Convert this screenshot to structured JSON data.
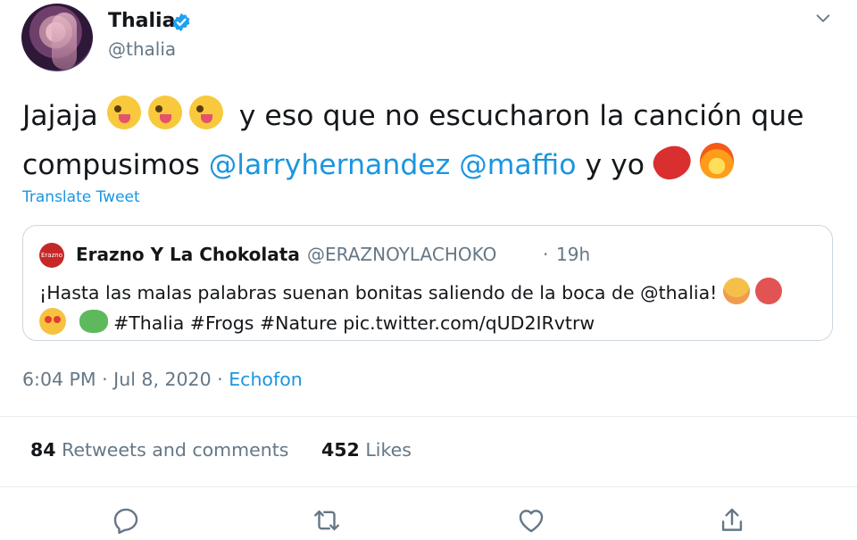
{
  "author": {
    "name": "Thalia",
    "handle": "@thalia"
  },
  "tweet": {
    "text_line1_start": "Jajaja",
    "text_line1_end": "y eso que no escucharon la canción que",
    "text_line2_start": "compusimos",
    "mention1": "@larryhernandez",
    "mention2": "@maffio",
    "text_line2_end": "y yo",
    "translate_label": "Translate Tweet",
    "emojis": [
      "winking-tongue-emoji",
      "winking-tongue-emoji",
      "winking-tongue-emoji",
      "hot-pepper-emoji",
      "fire-emoji"
    ]
  },
  "quoted_tweet": {
    "avatar_text": "Erazno Chokolata",
    "name": "Erazno Y La Chokolata",
    "handle": "@ERAZNOYLACHOKO",
    "dot": "·",
    "time": "19h",
    "text_line1": "¡Hasta las malas palabras suenan bonitas saliendo de la boca de @thalia!",
    "text_line2": "#Thalia #Frogs #Nature pic.twitter.com/qUD2IRvtrw",
    "emojis": [
      "smiling-face-with-hearts-emoji",
      "face-with-symbols-emoji",
      "heart-eyes-emoji",
      "frog-emoji"
    ]
  },
  "meta": {
    "time_date": "6:04 PM · Jul 8, 2020 ·",
    "client": "Echofon"
  },
  "stats": {
    "retweets_count": "84",
    "retweets_label": "Retweets and comments",
    "likes_count": "452",
    "likes_label": "Likes"
  },
  "icons": {
    "verified": "verified-badge-icon",
    "more": "chevron-down-icon",
    "reply": "reply-icon",
    "retweet": "retweet-icon",
    "like": "like-icon",
    "share": "share-icon"
  },
  "colors": {
    "link": "#1b95e0",
    "muted": "#657786",
    "text": "#14171a",
    "divider": "#e6ecf0"
  }
}
